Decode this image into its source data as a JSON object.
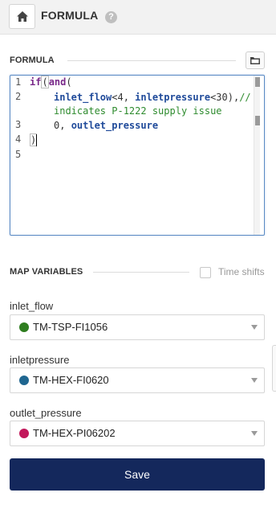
{
  "header": {
    "title": "FORMULA",
    "help_glyph": "?",
    "home_icon": "home-icon",
    "help_icon": "help-icon"
  },
  "formula_section": {
    "label": "FORMULA",
    "folder_icon": "folder-icon"
  },
  "editor": {
    "line_numbers": [
      "1",
      "2",
      "",
      "3",
      "4",
      "5"
    ],
    "lines": {
      "l1_kw1": "if",
      "l1_paren": "(",
      "l1_kw2": "and",
      "l1_rest": "(",
      "l2_var1": "inlet_flow",
      "l2_mid1": "<4, ",
      "l2_var2": "inletpressure",
      "l2_mid2": "<30),",
      "l2_comment_a": "//",
      "l2_comment_b": "indicates P-1222 supply issue",
      "l3_text": "0, ",
      "l3_var": "outlet_pressure",
      "l4_text": ")"
    }
  },
  "map_variables": {
    "label": "MAP VARIABLES",
    "time_shifts_label": "Time shifts",
    "time_shifts_checked": false,
    "variables": [
      {
        "name": "inlet_flow",
        "tag": "TM-TSP-FI1056",
        "color": "#2e7d1f"
      },
      {
        "name": "inletpressure",
        "tag": "TM-HEX-FI0620",
        "color": "#1f6690"
      },
      {
        "name": "outlet_pressure",
        "tag": "TM-HEX-PI06202",
        "color": "#c2185b"
      }
    ]
  },
  "actions": {
    "save_label": "Save"
  },
  "colors": {
    "primary_button": "#14285c",
    "editor_border": "#5b8bc4"
  }
}
